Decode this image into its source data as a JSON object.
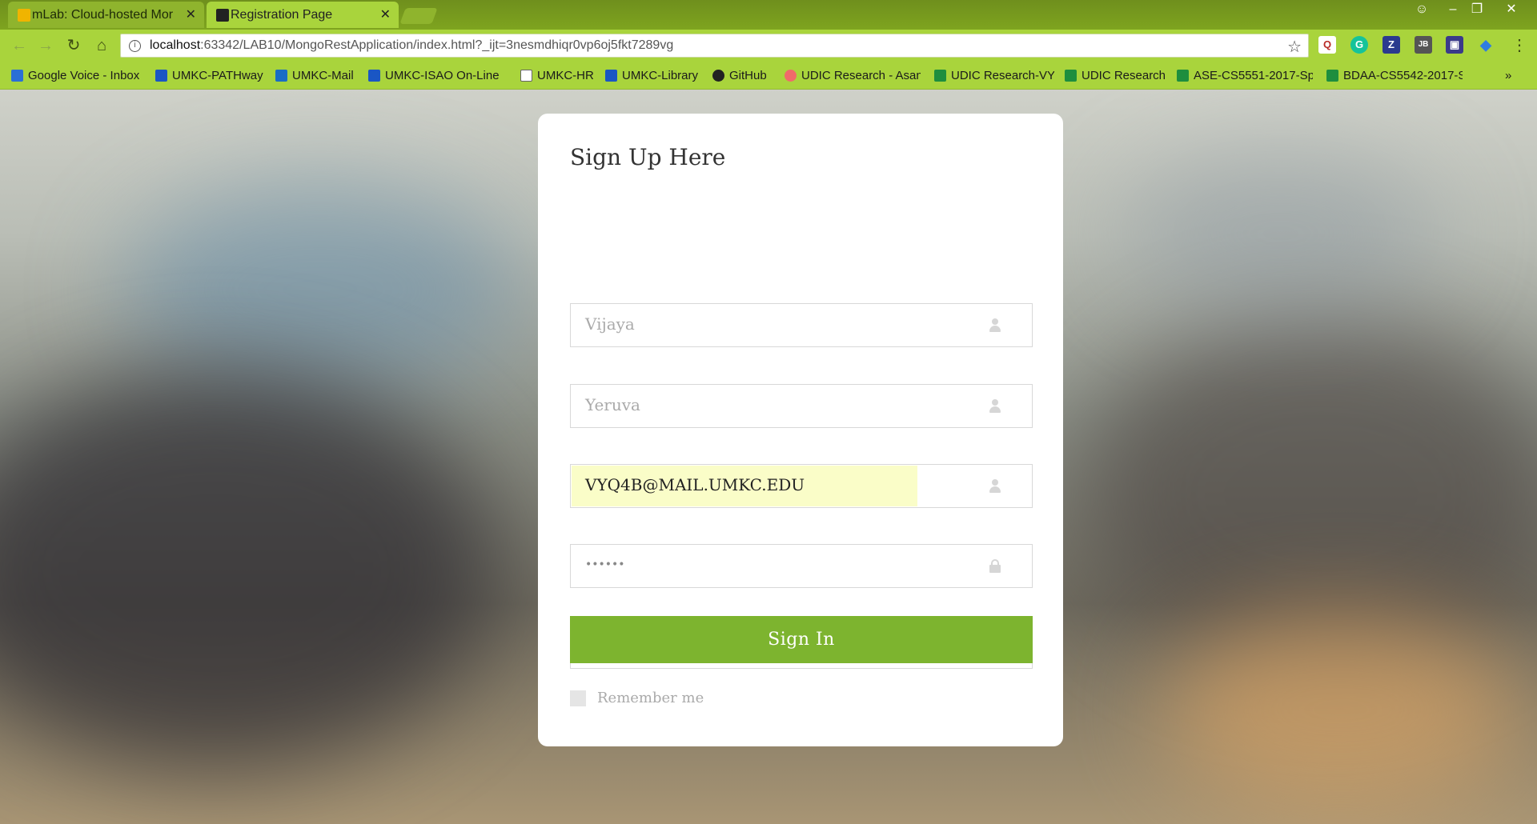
{
  "browser": {
    "tabs": [
      {
        "title": "mLab: Cloud-hosted Mor",
        "active": false,
        "favicon_color": "#f0b400"
      },
      {
        "title": "Registration Page",
        "active": true,
        "favicon_color": "#222222"
      }
    ],
    "url_host": "localhost",
    "url_rest": ":63342/LAB10/MongoRestApplication/index.html?_ijt=3nesmdhiqr0vp6oj5fkt7289vg",
    "window_controls": {
      "user": "☺",
      "minimize": "–",
      "restore": "❐",
      "close": "✕"
    },
    "nav": {
      "back": "←",
      "forward": "→",
      "reload": "↻",
      "home": "⌂",
      "star": "☆",
      "menu": "⋮"
    },
    "bookmarks": [
      {
        "label": "Google Voice - Inbox",
        "icon": "phone-icon",
        "color": "#2a6fd6"
      },
      {
        "label": "UMKC-PATHway",
        "icon": "umkc-icon",
        "color": "#1a56c4"
      },
      {
        "label": "UMKC-Mail",
        "icon": "outlook-icon",
        "color": "#1a6dc4"
      },
      {
        "label": "UMKC-ISAO On-Line",
        "icon": "umkc-icon",
        "color": "#1a56c4"
      },
      {
        "label": "UMKC-HR",
        "icon": "page-icon",
        "color": "#ffffff"
      },
      {
        "label": "UMKC-Library",
        "icon": "umkc-icon",
        "color": "#1a56c4"
      },
      {
        "label": "GitHub",
        "icon": "github-icon",
        "color": "#222222"
      },
      {
        "label": "UDIC Research - Asan",
        "icon": "asana-icon",
        "color": "#f06a6a"
      },
      {
        "label": "UDIC Research-VY",
        "icon": "sheets-icon",
        "color": "#1e8e3e"
      },
      {
        "label": "UDIC Research",
        "icon": "sheets-icon",
        "color": "#1e8e3e"
      },
      {
        "label": "ASE-CS5551-2017-Sp",
        "icon": "sheets-icon",
        "color": "#1e8e3e"
      },
      {
        "label": "BDAA-CS5542-2017-S",
        "icon": "sheets-icon",
        "color": "#1e8e3e"
      }
    ],
    "bookmarks_overflow": "»",
    "extensions": [
      {
        "name": "quora-extension-icon",
        "glyph": "Q",
        "color": "#b92b27"
      },
      {
        "name": "grammarly-extension-icon",
        "glyph": "G",
        "color": "#15c39a"
      },
      {
        "name": "zotero-extension-icon",
        "glyph": "Z",
        "color": "#2b3a8f"
      },
      {
        "name": "jb-extension-icon",
        "glyph": "JB",
        "color": "#333333"
      },
      {
        "name": "screen-extension-icon",
        "glyph": "▣",
        "color": "#3a3a8a"
      },
      {
        "name": "diamond-extension-icon",
        "glyph": "◆",
        "color": "#2f7de1"
      }
    ]
  },
  "form": {
    "title": "Sign Up Here",
    "fields": [
      {
        "name": "first-name-field",
        "value": "Vijaya",
        "filled": false,
        "icon": "user-icon"
      },
      {
        "name": "last-name-field",
        "value": "Yeruva",
        "filled": false,
        "icon": "user-icon"
      },
      {
        "name": "email-field",
        "value": "VYQ4B@MAIL.UMKC.EDU",
        "filled": true,
        "icon": "user-icon"
      },
      {
        "name": "password-field",
        "value": "••••••",
        "filled": false,
        "icon": "lock-icon"
      },
      {
        "name": "confirm-password-field",
        "value": "••••••",
        "filled": false,
        "icon": "lock-icon"
      }
    ],
    "submit_label": "Sign In",
    "remember_label": "Remember me"
  },
  "colors": {
    "accent": "#7db42f",
    "chrome": "#a9d43c"
  }
}
